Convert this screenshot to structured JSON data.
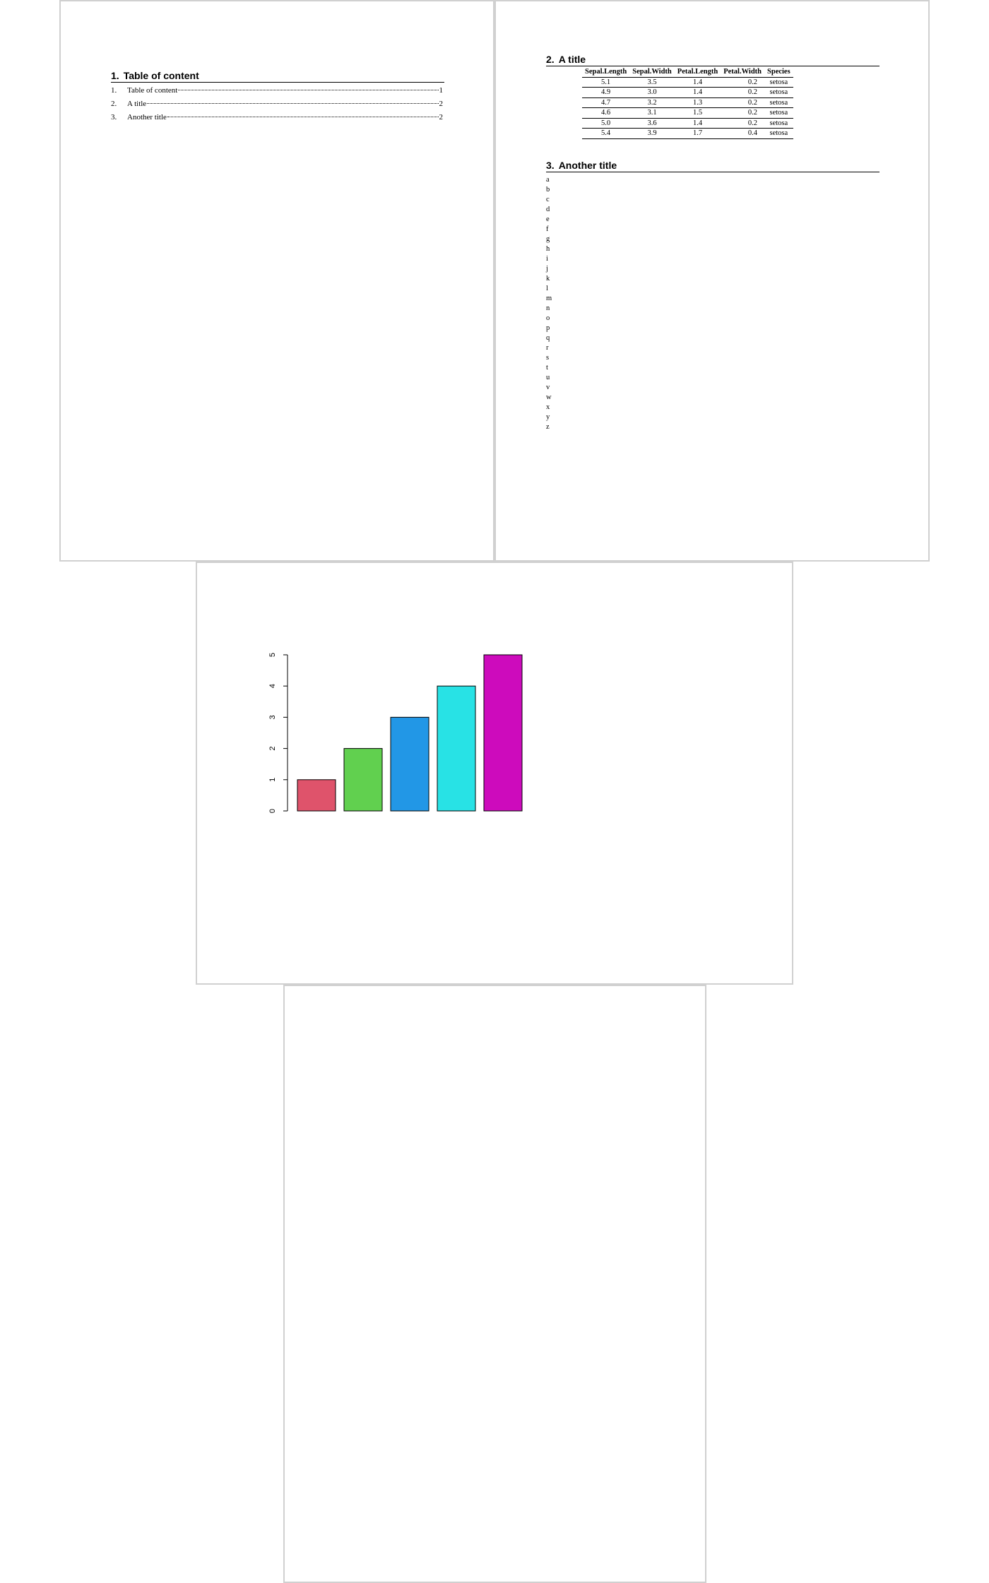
{
  "toc": {
    "heading_num": "1.",
    "heading_title": "Table of content",
    "items": [
      {
        "num": "1.",
        "label": "Table of content",
        "page": "1"
      },
      {
        "num": "2.",
        "label": "A title",
        "page": "2"
      },
      {
        "num": "3.",
        "label": "Another title",
        "page": "2"
      }
    ]
  },
  "section2": {
    "num": "2.",
    "title": "A title",
    "table": {
      "headers": [
        "Sepal.Length",
        "Sepal.Width",
        "Petal.Length",
        "Petal.Width",
        "Species"
      ],
      "rows": [
        [
          "5.1",
          "3.5",
          "1.4",
          "0.2",
          "setosa"
        ],
        [
          "4.9",
          "3.0",
          "1.4",
          "0.2",
          "setosa"
        ],
        [
          "4.7",
          "3.2",
          "1.3",
          "0.2",
          "setosa"
        ],
        [
          "4.6",
          "3.1",
          "1.5",
          "0.2",
          "setosa"
        ],
        [
          "5.0",
          "3.6",
          "1.4",
          "0.2",
          "setosa"
        ],
        [
          "5.4",
          "3.9",
          "1.7",
          "0.4",
          "setosa"
        ]
      ]
    }
  },
  "section3": {
    "num": "3.",
    "title": "Another title",
    "letters": [
      "a",
      "b",
      "c",
      "d",
      "e",
      "f",
      "g",
      "h",
      "i",
      "j",
      "k",
      "l",
      "m",
      "n",
      "o",
      "p",
      "q",
      "r",
      "s",
      "t",
      "u",
      "v",
      "w",
      "x",
      "y",
      "z"
    ]
  },
  "chart_data": {
    "type": "bar",
    "categories": [
      "",
      "",
      "",
      "",
      ""
    ],
    "values": [
      1,
      2,
      3,
      4,
      5
    ],
    "colors": [
      "#df536b",
      "#61d04f",
      "#2297e6",
      "#28e2e5",
      "#cd0bbc"
    ],
    "yticks": [
      "0",
      "1",
      "2",
      "3",
      "4",
      "5"
    ],
    "ylim": [
      0,
      5
    ],
    "title": "",
    "xlabel": "",
    "ylabel": "",
    "grid": false
  }
}
